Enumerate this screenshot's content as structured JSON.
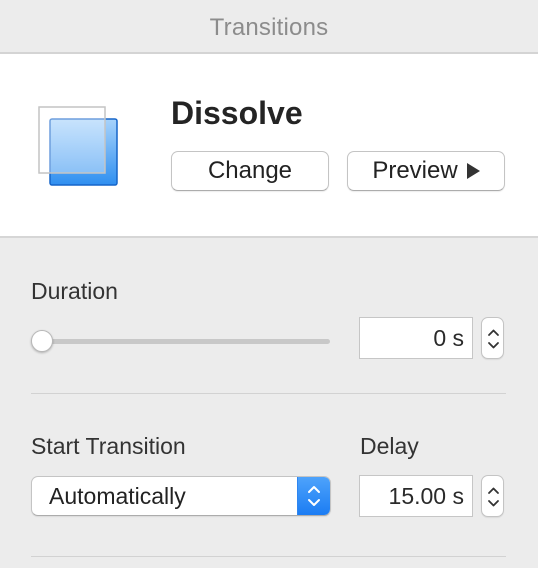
{
  "panel": {
    "title": "Transitions"
  },
  "transition": {
    "name": "Dissolve",
    "thumbnail_icon": "dissolve-thumbnail-icon",
    "change_label": "Change",
    "preview_label": "Preview",
    "preview_icon": "play-triangle-icon"
  },
  "duration": {
    "label": "Duration",
    "value": "0 s",
    "slider_fraction": 0
  },
  "start_transition": {
    "label": "Start Transition",
    "selected": "Automatically"
  },
  "delay": {
    "label": "Delay",
    "value": "15.00 s"
  },
  "colors": {
    "accent": "#1b7cf3",
    "panel_bg": "#ececec",
    "content_bg": "#ffffff"
  }
}
